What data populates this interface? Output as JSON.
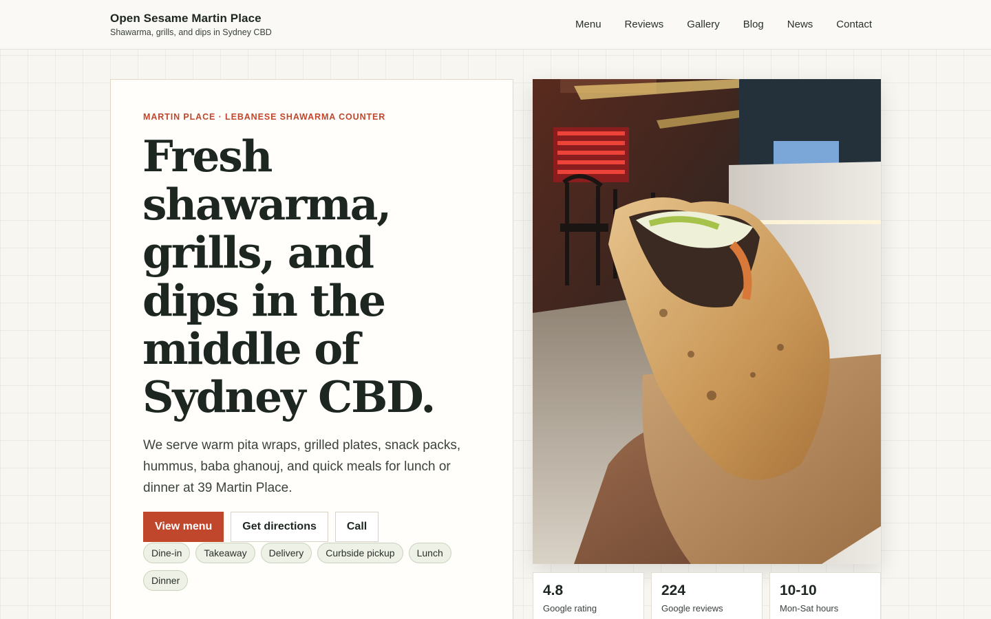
{
  "header": {
    "brand_name": "Open Sesame Martin Place",
    "tagline": "Shawarma, grills, and dips in Sydney CBD",
    "nav": [
      "Menu",
      "Reviews",
      "Gallery",
      "Blog",
      "News",
      "Contact"
    ]
  },
  "hero": {
    "eyebrow": "MARTIN PLACE · LEBANESE SHAWARMA COUNTER",
    "headline": "Fresh shawarma, grills, and dips in the middle of Sydney CBD.",
    "lead": "We serve warm pita wraps, grilled plates, snack packs, hummus, baba ghanouj, and quick meals for lunch or dinner at 39 Martin Place.",
    "buttons": [
      "View menu",
      "Get directions",
      "Call"
    ],
    "tags": [
      "Dine-in",
      "Takeaway",
      "Delivery",
      "Curbside pickup",
      "Lunch",
      "Dinner"
    ]
  },
  "photo": {
    "alt_icon": "shawarma-wrap-photo"
  },
  "stats": [
    {
      "value": "4.8",
      "label": "Google rating"
    },
    {
      "value": "224",
      "label": "Google reviews"
    },
    {
      "value": "10-10",
      "label": "Mon-Sat hours"
    }
  ],
  "colors": {
    "accent": "#c0462c",
    "ink": "#1d2620",
    "tag_bg": "#edf1e6",
    "page_bg": "#f8f6f0"
  }
}
